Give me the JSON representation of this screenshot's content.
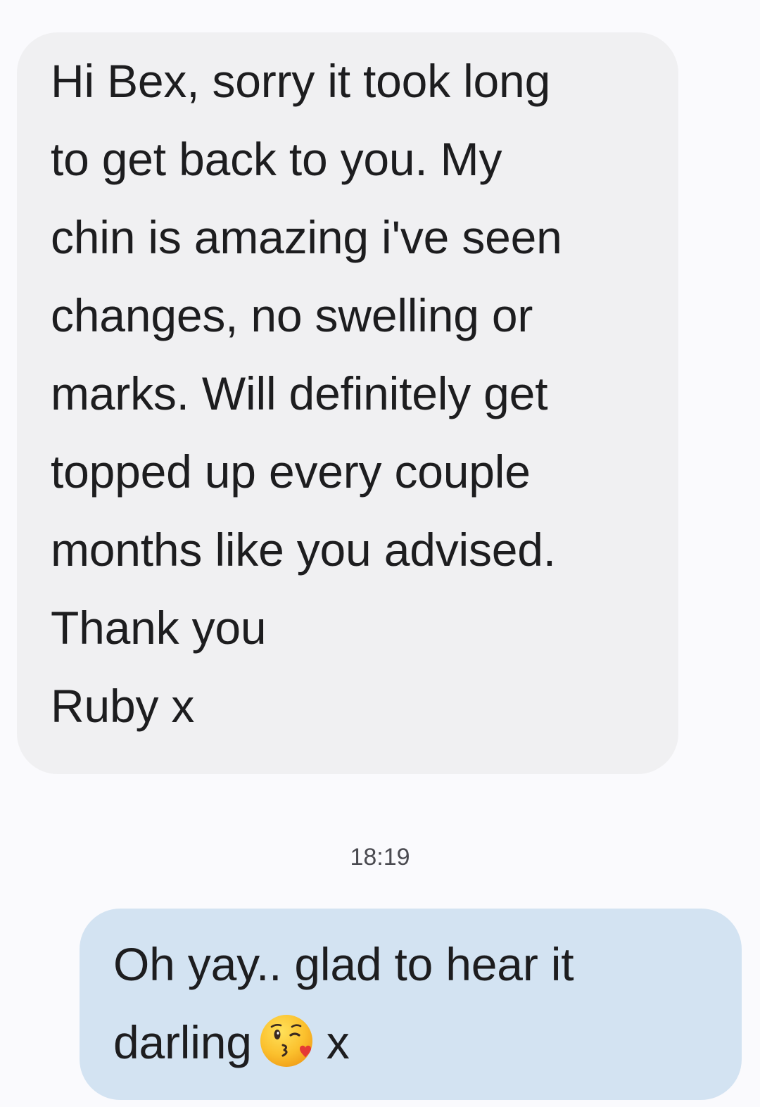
{
  "conversation": {
    "incoming_message": {
      "lines": [
        "Hi Bex, sorry it took long",
        "to get back to you. My",
        "chin is amazing i've seen",
        "changes, no swelling or",
        "marks. Will definitely get",
        "topped up every couple",
        "months like you advised.",
        "Thank you",
        "Ruby x"
      ]
    },
    "timestamp": "18:19",
    "outgoing_message": {
      "line1": "Oh yay.. glad to hear it",
      "line2_text": "darling",
      "emoji": "face-blowing-a-kiss-icon",
      "line2_suffix": "x"
    }
  },
  "colors": {
    "background": "#fafafd",
    "incoming_bubble": "#f0f0f2",
    "outgoing_bubble": "#d3e3f2",
    "text": "#1d1d1f",
    "timestamp": "#4a4a50"
  }
}
